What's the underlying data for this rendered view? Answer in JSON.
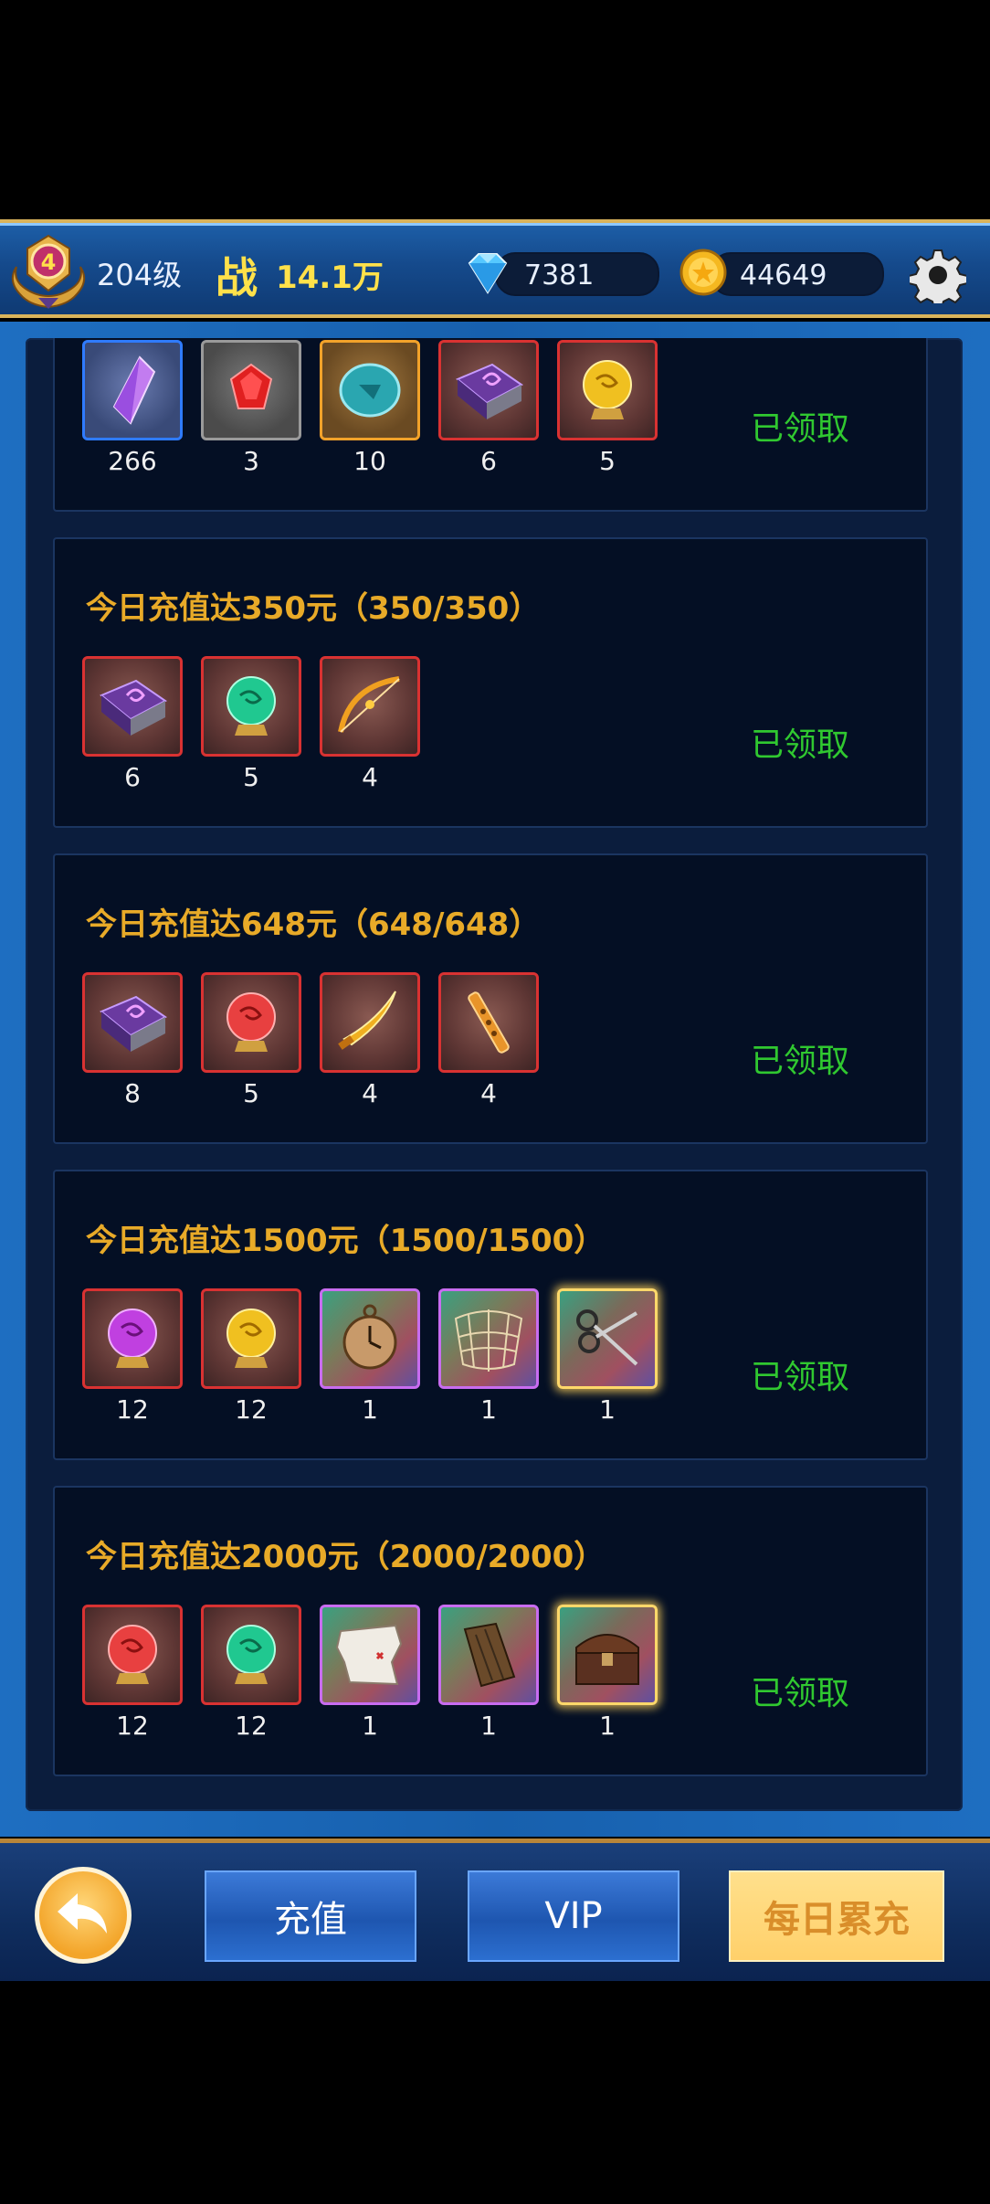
{
  "header": {
    "rank_number": "4",
    "level_text": "204级",
    "power_label": "战",
    "power_value": "14.1万",
    "diamonds": "7381",
    "gold": "44649"
  },
  "tiers": [
    {
      "title": "",
      "status": "已领取",
      "items": [
        {
          "icon": "purple-crystal-icon",
          "count": "266"
        },
        {
          "icon": "red-gem-icon",
          "count": "3"
        },
        {
          "icon": "jade-token-icon",
          "count": "10"
        },
        {
          "icon": "spell-book-icon",
          "count": "6"
        },
        {
          "icon": "yellow-orb-icon",
          "count": "5"
        }
      ]
    },
    {
      "title": "今日充值达350元（350/350）",
      "status": "已领取",
      "items": [
        {
          "icon": "spell-book-icon",
          "count": "6"
        },
        {
          "icon": "green-orb-icon",
          "count": "5"
        },
        {
          "icon": "bow-icon",
          "count": "4"
        }
      ]
    },
    {
      "title": "今日充值达648元（648/648）",
      "status": "已领取",
      "items": [
        {
          "icon": "spell-book-icon",
          "count": "8"
        },
        {
          "icon": "red-orb-icon",
          "count": "5"
        },
        {
          "icon": "golden-blade-icon",
          "count": "4"
        },
        {
          "icon": "flute-icon",
          "count": "4"
        }
      ]
    },
    {
      "title": "今日充值达1500元（1500/1500）",
      "status": "已领取",
      "items": [
        {
          "icon": "purple-orb-icon",
          "count": "12"
        },
        {
          "icon": "yellow-orb-icon",
          "count": "12"
        },
        {
          "icon": "pocket-watch-icon",
          "count": "1"
        },
        {
          "icon": "net-icon",
          "count": "1"
        },
        {
          "icon": "scissors-icon",
          "count": "1"
        }
      ]
    },
    {
      "title": "今日充值达2000元（2000/2000）",
      "status": "已领取",
      "items": [
        {
          "icon": "red-orb-icon",
          "count": "12"
        },
        {
          "icon": "green-orb-icon",
          "count": "12"
        },
        {
          "icon": "map-icon",
          "count": "1"
        },
        {
          "icon": "wood-plank-icon",
          "count": "1"
        },
        {
          "icon": "treasure-chest-icon",
          "count": "1"
        }
      ]
    }
  ],
  "footer": {
    "recharge_label": "充值",
    "vip_label": "VIP",
    "daily_label": "每日累充"
  }
}
